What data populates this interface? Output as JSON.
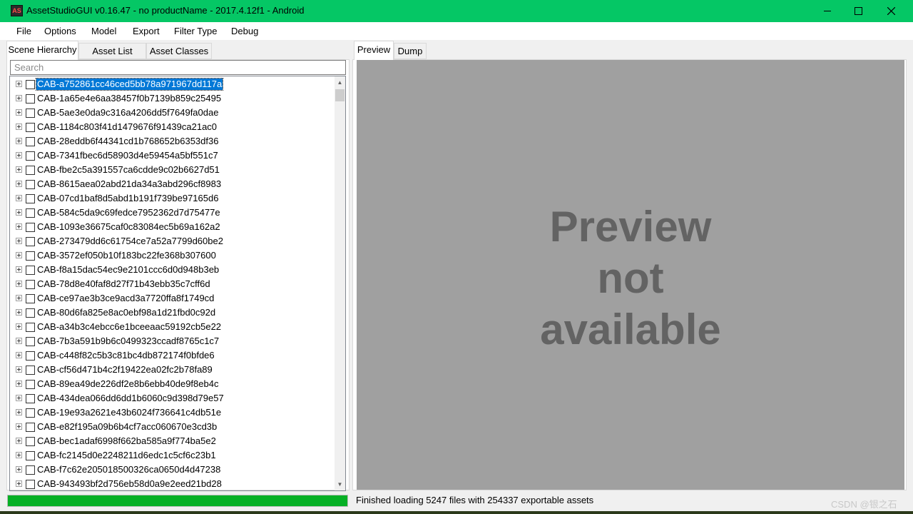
{
  "window": {
    "title": "AssetStudioGUI v0.16.47 - no productName - 2017.4.12f1 - Android",
    "icon_text": "AS"
  },
  "menu": [
    "File",
    "Options",
    "Model",
    "Export",
    "Filter Type",
    "Debug"
  ],
  "left_tabs": [
    "Scene Hierarchy",
    "Asset List",
    "Asset Classes"
  ],
  "search": {
    "placeholder": "Search",
    "value": ""
  },
  "tree_items": [
    "CAB-a752861cc46ced5bb78a971967dd117a",
    "CAB-1a65e4e6aa38457f0b7139b859c25495",
    "CAB-5ae3e0da9c316a4206dd5f7649fa0dae",
    "CAB-1184c803f41d1479676f91439ca21ac0",
    "CAB-28eddb6f44341cd1b768652b6353df36",
    "CAB-7341fbec6d58903d4e59454a5bf551c7",
    "CAB-fbe2c5a391557ca6cdde9c02b6627d51",
    "CAB-8615aea02abd21da34a3abd296cf8983",
    "CAB-07cd1baf8d5abd1b191f739be97165d6",
    "CAB-584c5da9c69fedce7952362d7d75477e",
    "CAB-1093e36675caf0c83084ec5b69a162a2",
    "CAB-273479dd6c61754ce7a52a7799d60be2",
    "CAB-3572ef050b10f183bc22fe368b307600",
    "CAB-f8a15dac54ec9e2101ccc6d0d948b3eb",
    "CAB-78d8e40faf8d27f71b43ebb35c7cff6d",
    "CAB-ce97ae3b3ce9acd3a7720ffa8f1749cd",
    "CAB-80d6fa825e8ac0ebf98a1d21fbd0c92d",
    "CAB-a34b3c4ebcc6e1bceeaac59192cb5e22",
    "CAB-7b3a591b9b6c0499323ccadf8765c1c7",
    "CAB-c448f82c5b3c81bc4db872174f0bfde6",
    "CAB-cf56d471b4c2f19422ea02fc2b78fa89",
    "CAB-89ea49de226df2e8b6ebb40de9f8eb4c",
    "CAB-434dea066dd6dd1b6060c9d398d79e57",
    "CAB-19e93a2621e43b6024f736641c4db51e",
    "CAB-e82f195a09b6b4cf7acc060670e3cd3b",
    "CAB-bec1adaf6998f662ba585a9f774ba5e2",
    "CAB-fc2145d0e2248211d6edc1c5cf6c23b1",
    "CAB-f7c62e205018500326ca0650d4d47238",
    "CAB-943493bf2d756eb58d0a9e2eed21bd28"
  ],
  "selected_index": 0,
  "progress_percent": 100,
  "right_tabs": [
    "Preview",
    "Dump"
  ],
  "preview": {
    "lines": [
      "Preview",
      "not",
      "available"
    ]
  },
  "status_text": "Finished loading 5247 files with 254337 exportable assets",
  "watermark": "CSDN @银之石",
  "colors": {
    "titlebar": "#05c765",
    "selection": "#0078d7",
    "progress": "#06b025",
    "preview_bg": "#a0a0a0"
  }
}
